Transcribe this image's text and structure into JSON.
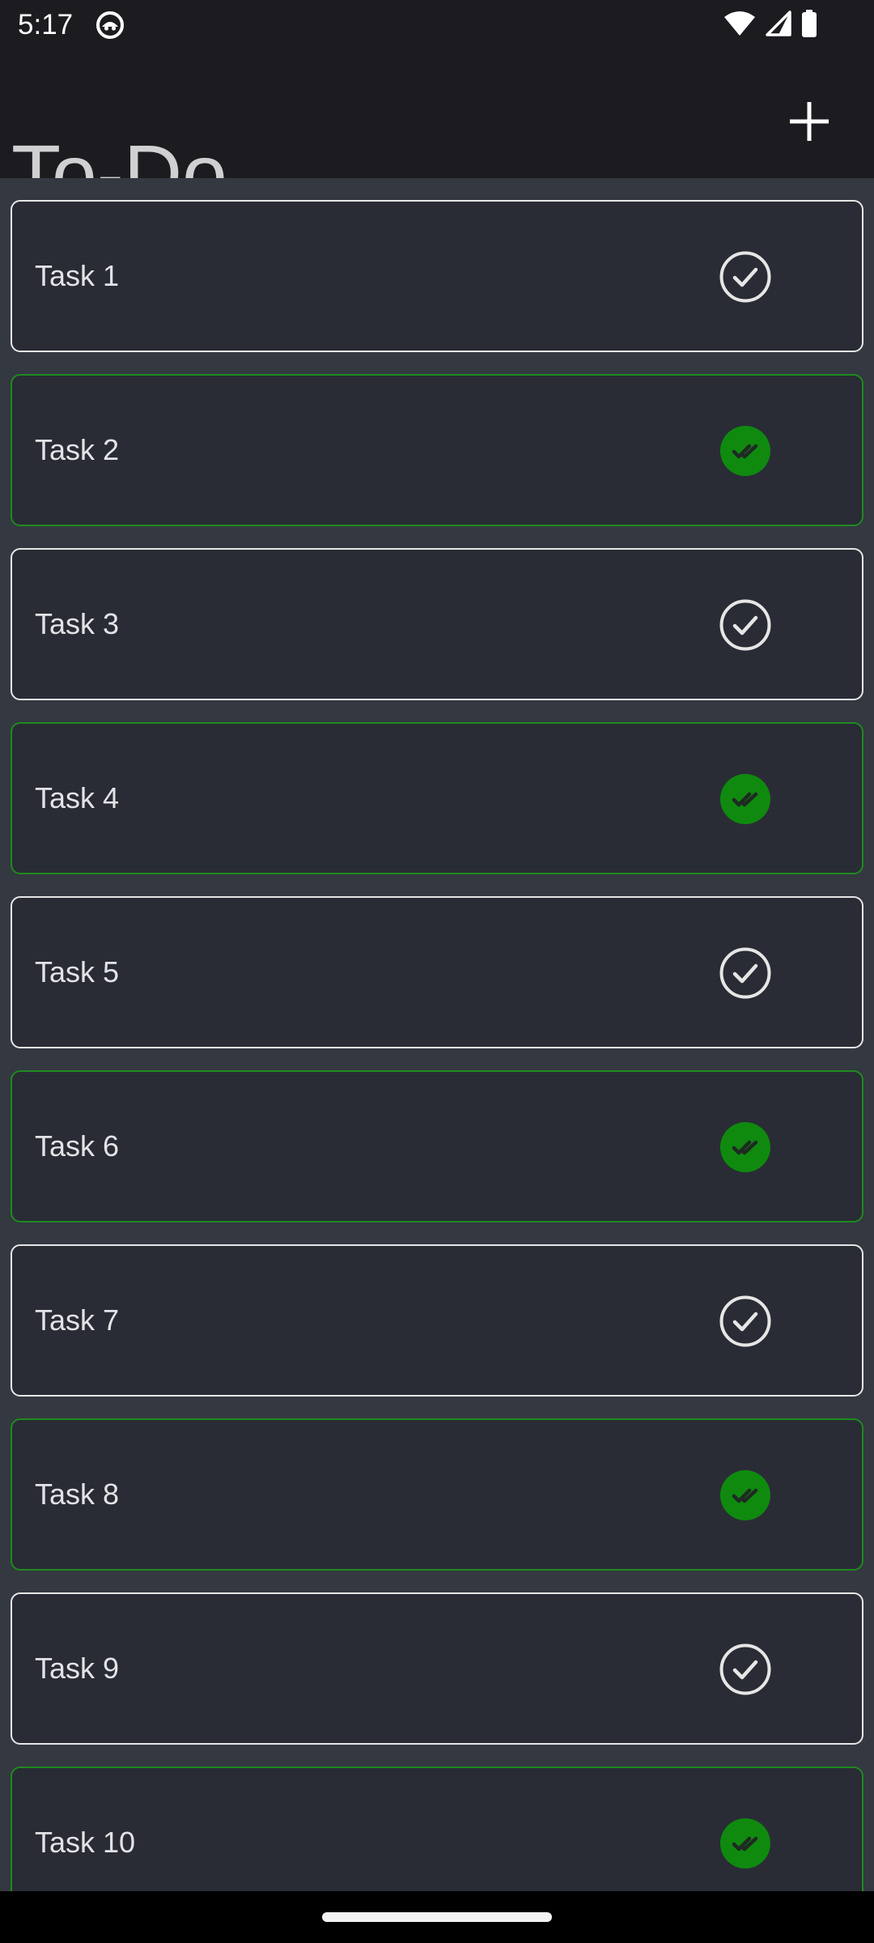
{
  "status_bar": {
    "time": "5:17",
    "notification_icon": "android-face-icon",
    "wifi_icon": "wifi-icon",
    "signal_icon": "cell-signal-icon",
    "battery_icon": "battery-icon"
  },
  "app_bar": {
    "title": "To-Do",
    "add_icon": "plus-icon"
  },
  "colors": {
    "done_accent": "#0f8a0f",
    "card_bg": "#292c35",
    "list_bg": "#343841",
    "app_bar_bg": "#1c1c20"
  },
  "tasks": [
    {
      "label": "Task 1",
      "done": false
    },
    {
      "label": "Task 2",
      "done": true
    },
    {
      "label": "Task 3",
      "done": false
    },
    {
      "label": "Task 4",
      "done": true
    },
    {
      "label": "Task 5",
      "done": false
    },
    {
      "label": "Task 6",
      "done": true
    },
    {
      "label": "Task 7",
      "done": false
    },
    {
      "label": "Task 8",
      "done": true
    },
    {
      "label": "Task 9",
      "done": false
    },
    {
      "label": "Task 10",
      "done": true
    }
  ]
}
